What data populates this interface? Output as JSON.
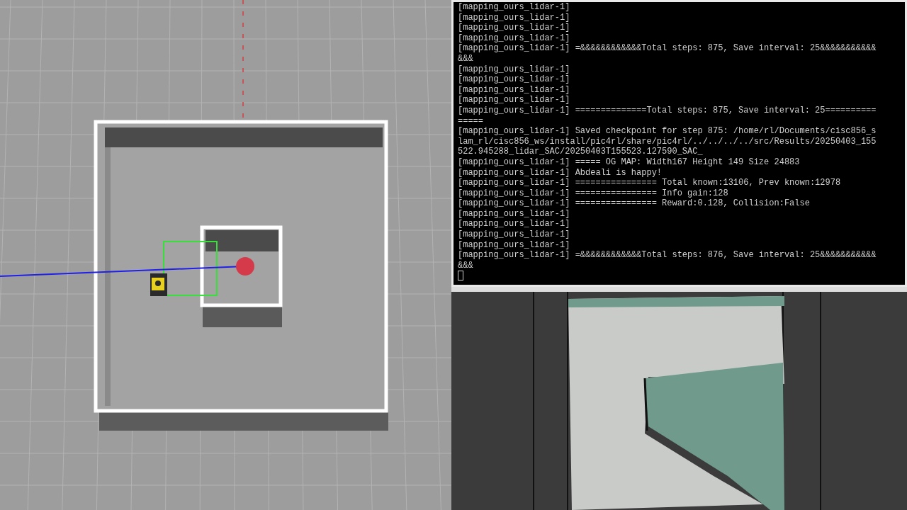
{
  "terminal": {
    "lines": [
      "[mapping_ours_lidar-1]",
      "[mapping_ours_lidar-1]",
      "[mapping_ours_lidar-1]",
      "[mapping_ours_lidar-1]",
      "[mapping_ours_lidar-1] =&&&&&&&&&&&&Total steps: 875, Save interval: 25&&&&&&&&&&&&&&",
      "[mapping_ours_lidar-1]",
      "[mapping_ours_lidar-1]",
      "[mapping_ours_lidar-1]",
      "[mapping_ours_lidar-1]",
      "[mapping_ours_lidar-1] ==============Total steps: 875, Save interval: 25===============",
      "[mapping_ours_lidar-1] Saved checkpoint for step 875: /home/rl/Documents/cisc856_slam_rl/cisc856_ws/install/pic4rl/share/pic4rl/../../../../src/Results/20250403_155522.945288_lidar_SAC/20250403T155523.127590_SAC_",
      "[mapping_ours_lidar-1] ===== OG MAP: Width167 Height 149 Size 24883",
      "[mapping_ours_lidar-1] Abdeali is happy!",
      "[mapping_ours_lidar-1] ================ Total known:13106, Prev known:12978",
      "[mapping_ours_lidar-1] ================ Info gain:128",
      "[mapping_ours_lidar-1] ================ Reward:0.128, Collision:False",
      "[mapping_ours_lidar-1]",
      "[mapping_ours_lidar-1]",
      "[mapping_ours_lidar-1]",
      "[mapping_ours_lidar-1]",
      "[mapping_ours_lidar-1] =&&&&&&&&&&&&Total steps: 876, Save interval: 25&&&&&&&&&&&&&&"
    ]
  }
}
